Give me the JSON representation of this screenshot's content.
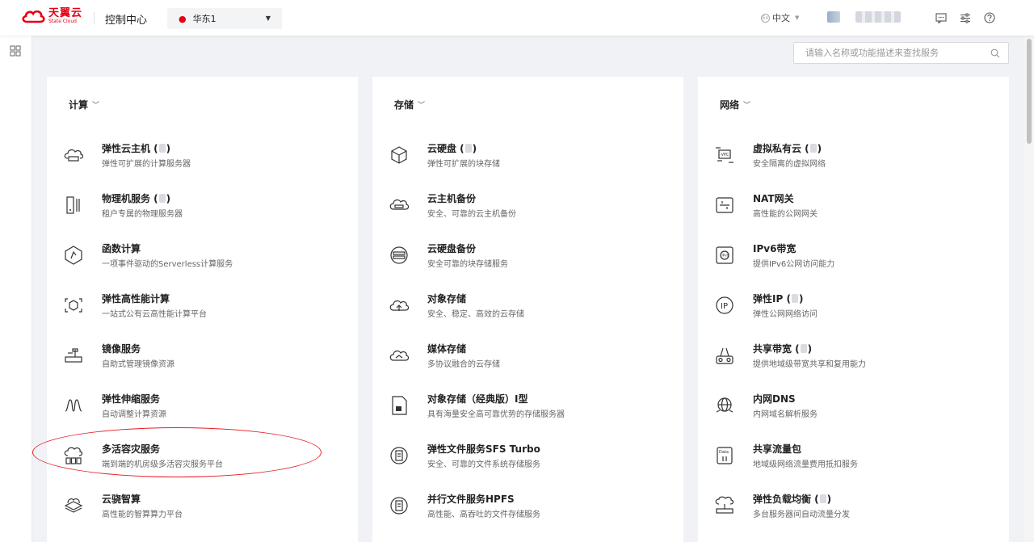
{
  "header": {
    "logo_cn": "天翼云",
    "logo_en": "State Cloud",
    "console_title": "控制中心",
    "region": "华东1",
    "language": "中文"
  },
  "search": {
    "placeholder": "请输入名称或功能描述来查找服务"
  },
  "colors": {
    "brand": "#e60012",
    "annotation": "#e51c23"
  },
  "categories": [
    {
      "title": "计算",
      "services": [
        {
          "name": "弹性云主机 (",
          "suffix": ")",
          "has_blur": true,
          "desc": "弹性可扩展的计算服务器",
          "icon": "cloud-server-icon"
        },
        {
          "name": "物理机服务 (",
          "suffix": ")",
          "has_blur": true,
          "desc": "租户专属的物理服务器",
          "icon": "physical-server-icon"
        },
        {
          "name": "函数计算",
          "suffix": "",
          "has_blur": false,
          "desc": "一项事件驱动的Serverless计算服务",
          "icon": "function-icon"
        },
        {
          "name": "弹性高性能计算",
          "suffix": "",
          "has_blur": false,
          "desc": "一站式公有云高性能计算平台",
          "icon": "hpc-icon"
        },
        {
          "name": "镜像服务",
          "suffix": "",
          "has_blur": false,
          "desc": "自助式管理镜像资源",
          "icon": "image-service-icon"
        },
        {
          "name": "弹性伸缩服务",
          "suffix": "",
          "has_blur": false,
          "desc": "自动调整计算资源",
          "icon": "autoscaling-icon"
        },
        {
          "name": "多活容灾服务",
          "suffix": "",
          "has_blur": false,
          "desc": "端到端的机房级多活容灾服务平台",
          "icon": "disaster-recovery-icon"
        },
        {
          "name": "云骁智算",
          "suffix": "",
          "has_blur": false,
          "desc": "高性能的智算算力平台",
          "icon": "ai-compute-icon"
        }
      ]
    },
    {
      "title": "存储",
      "services": [
        {
          "name": "云硬盘 (",
          "suffix": ")",
          "has_blur": true,
          "desc": "弹性可扩展的块存储",
          "icon": "cube-icon"
        },
        {
          "name": "云主机备份",
          "suffix": "",
          "has_blur": false,
          "desc": "安全、可靠的云主机备份",
          "icon": "server-backup-icon"
        },
        {
          "name": "云硬盘备份",
          "suffix": "",
          "has_blur": false,
          "desc": "安全可靠的块存储服务",
          "icon": "disk-backup-icon"
        },
        {
          "name": "对象存储",
          "suffix": "",
          "has_blur": false,
          "desc": "安全、稳定、高效的云存储",
          "icon": "cloud-upload-icon"
        },
        {
          "name": "媒体存储",
          "suffix": "",
          "has_blur": false,
          "desc": "多协议融合的云存储",
          "icon": "media-cloud-icon"
        },
        {
          "name": "对象存储（经典版）I型",
          "suffix": "",
          "has_blur": false,
          "desc": "具有海量安全高可靠优势的存储服务器",
          "icon": "document-icon"
        },
        {
          "name": "弹性文件服务SFS Turbo",
          "suffix": "",
          "has_blur": false,
          "desc": "安全、可靠的文件系统存储服务",
          "icon": "file-service-icon"
        },
        {
          "name": "并行文件服务HPFS",
          "suffix": "",
          "has_blur": false,
          "desc": "高性能、高吞吐的文件存储服务",
          "icon": "parallel-file-icon"
        }
      ]
    },
    {
      "title": "网络",
      "services": [
        {
          "name": "虚拟私有云 (",
          "suffix": ")",
          "has_blur": true,
          "desc": "安全隔离的虚拟网络",
          "icon": "vpc-icon"
        },
        {
          "name": "NAT网关",
          "suffix": "",
          "has_blur": false,
          "desc": "高性能的公网网关",
          "icon": "nat-gateway-icon"
        },
        {
          "name": "IPv6带宽",
          "suffix": "",
          "has_blur": false,
          "desc": "提供IPv6公网访问能力",
          "icon": "ipv6-icon"
        },
        {
          "name": "弹性IP (",
          "suffix": ")",
          "has_blur": true,
          "desc": "弹性公网网络访问",
          "icon": "elastic-ip-icon"
        },
        {
          "name": "共享带宽 (",
          "suffix": ")",
          "has_blur": true,
          "desc": "提供地域级带宽共享和复用能力",
          "icon": "shared-bandwidth-icon"
        },
        {
          "name": "内网DNS",
          "suffix": "",
          "has_blur": false,
          "desc": "内网域名解析服务",
          "icon": "dns-globe-icon"
        },
        {
          "name": "共享流量包",
          "suffix": "",
          "has_blur": false,
          "desc": "地域级网络流量费用抵扣服务",
          "icon": "data-package-icon"
        },
        {
          "name": "弹性负载均衡 (",
          "suffix": ")",
          "has_blur": true,
          "desc": "多台服务器间自动流量分发",
          "icon": "load-balancer-icon"
        }
      ]
    }
  ]
}
